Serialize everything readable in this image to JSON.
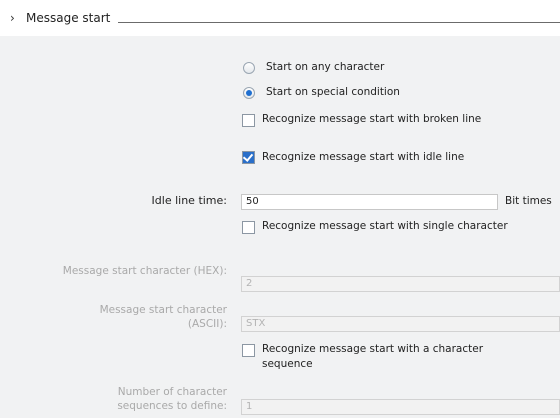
{
  "section": {
    "title": "Message start",
    "chevron": "›"
  },
  "options": {
    "any_char": "Start on any character",
    "special": "Start on special condition",
    "broken_line": "Recognize message start with broken line",
    "idle_line": "Recognize message start with idle line",
    "single_char": "Recognize message start with single character",
    "char_seq_line1": "Recognize message start with a character",
    "char_seq_line2": "sequence"
  },
  "fields": {
    "idle_time": {
      "label": "Idle line time:",
      "value": "50",
      "unit": "Bit times"
    },
    "hex": {
      "label": "Message start character (HEX):",
      "value": "2"
    },
    "ascii": {
      "label_line1": "Message start character",
      "label_line2": "(ASCII):",
      "value": "STX"
    },
    "num_seq": {
      "label_line1": "Number of character",
      "label_line2": "sequences to define:",
      "value": "1"
    }
  },
  "state": {
    "radio_selected": "special",
    "broken_line_checked": false,
    "idle_line_checked": true,
    "single_char_checked": false,
    "char_seq_checked": false
  }
}
